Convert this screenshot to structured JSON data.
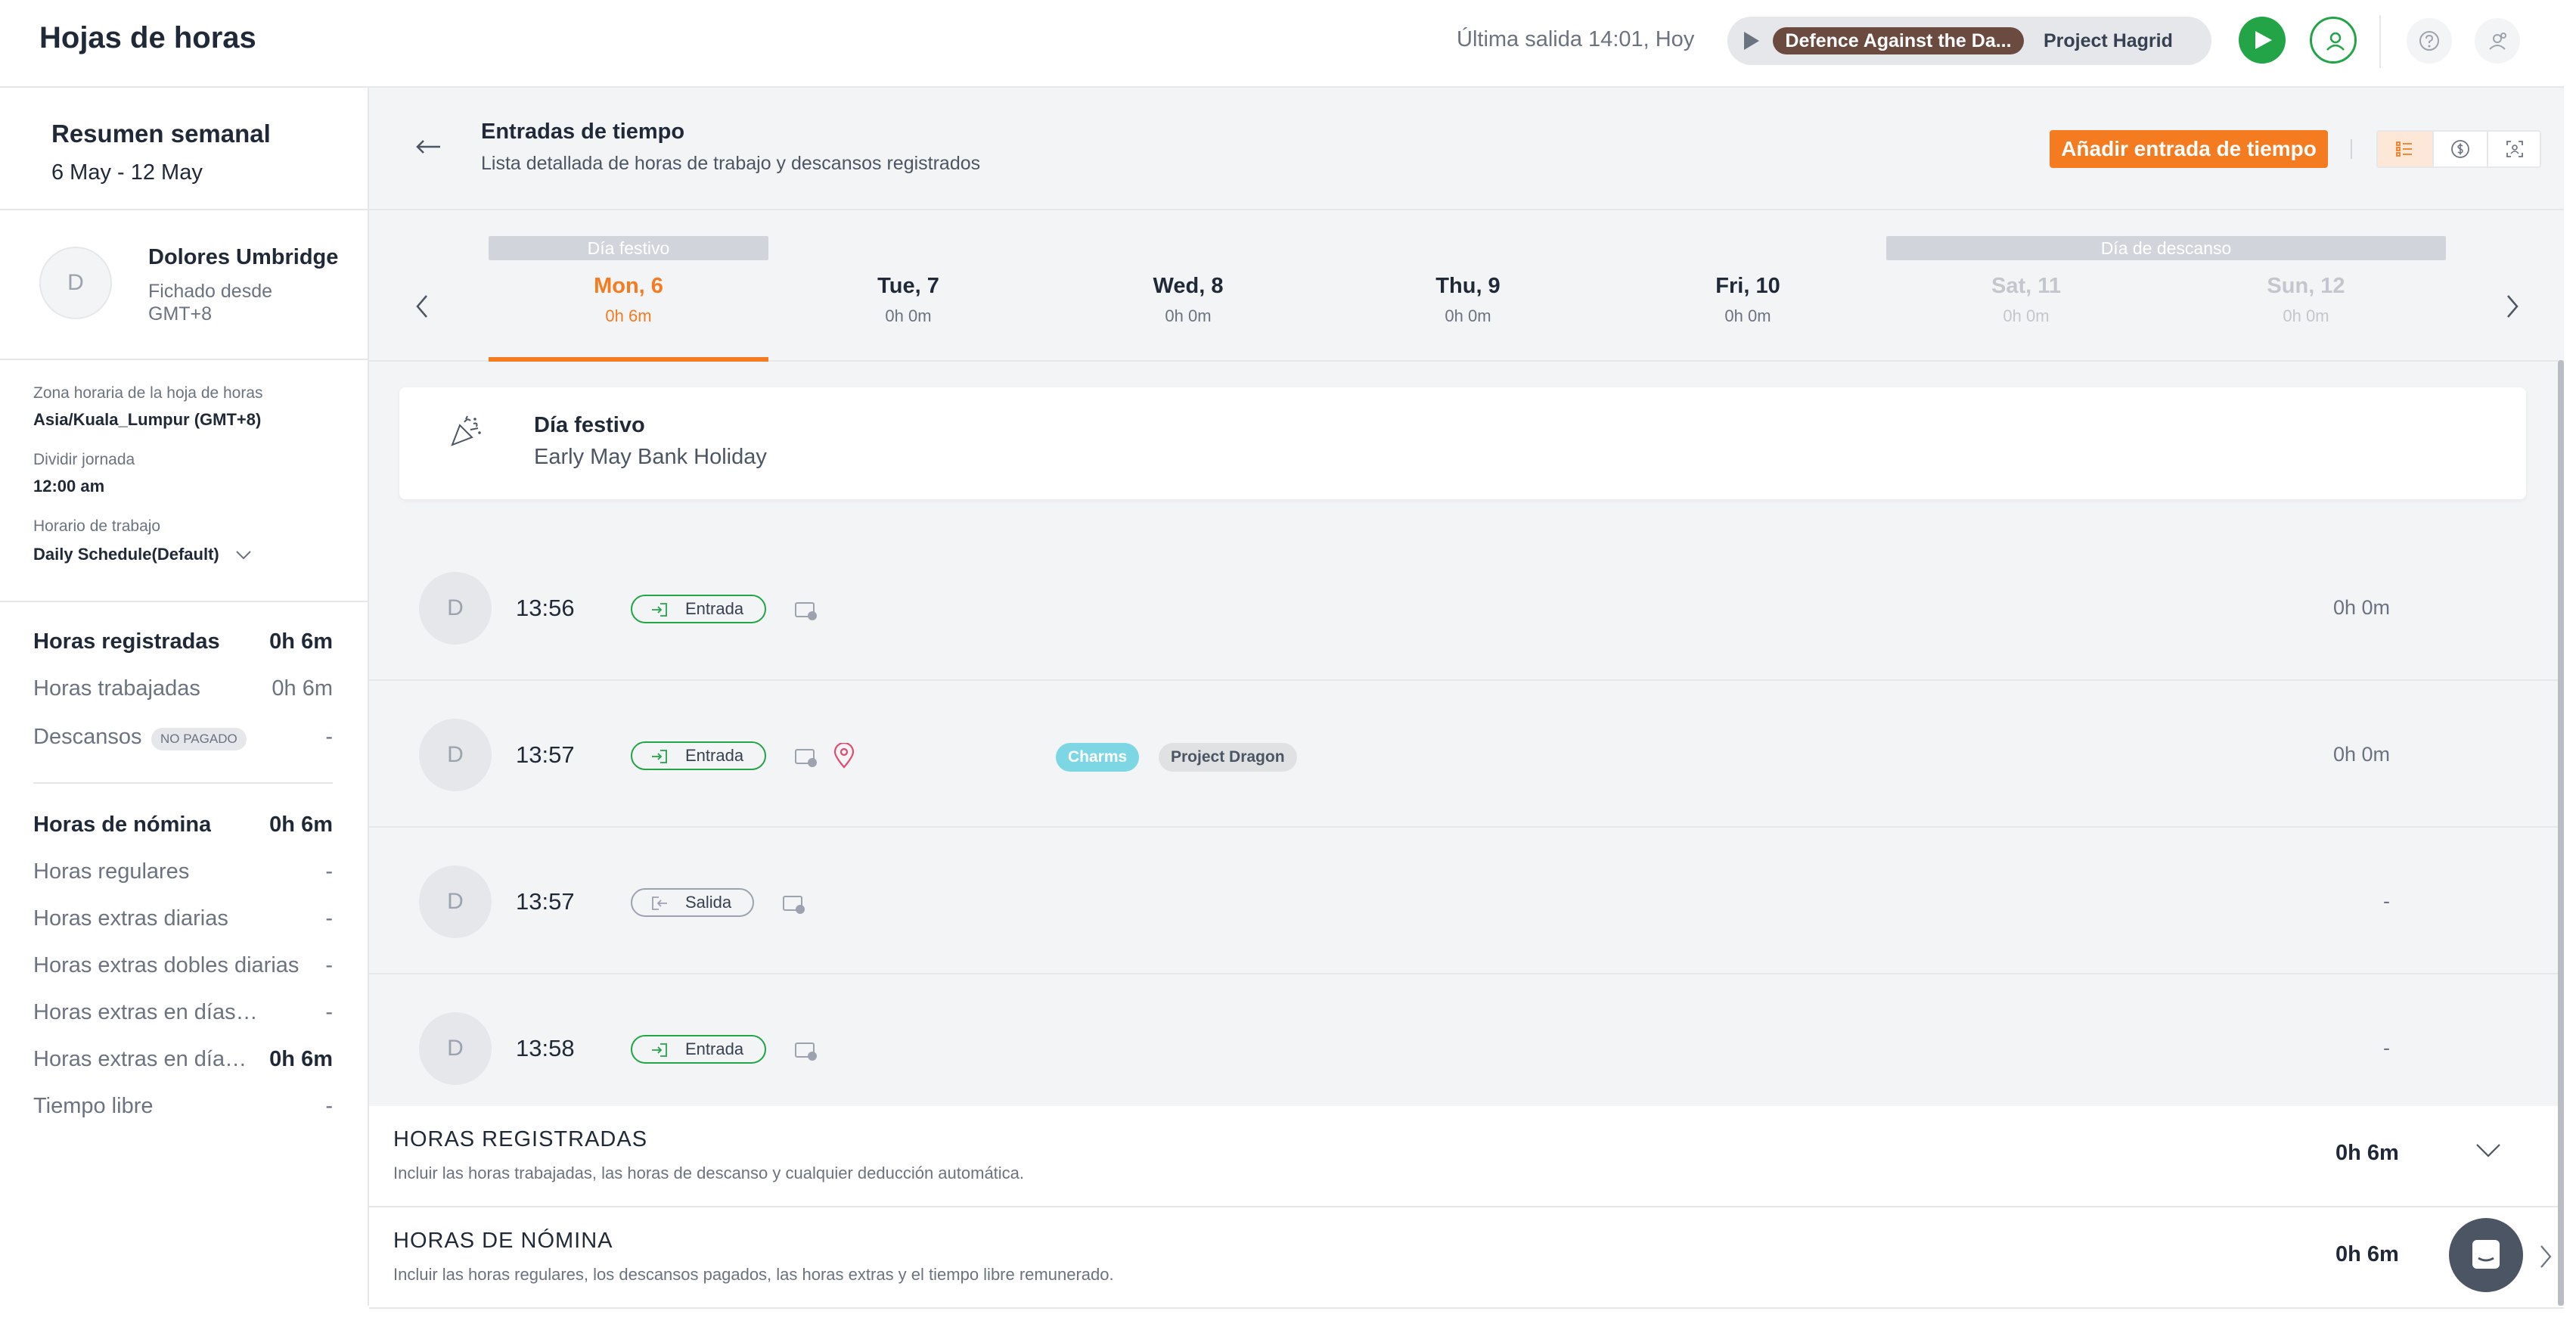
{
  "header": {
    "title": "Hojas de horas",
    "last_out": "Última salida 14:01, Hoy",
    "timer": {
      "task": "Defence Against the Da...",
      "project": "Project Hagrid"
    },
    "icons": [
      "play-icon",
      "user-circle-icon",
      "help-icon",
      "settings-icon"
    ]
  },
  "sidebar": {
    "weekly_title": "Resumen semanal",
    "date_range": "6 May - 12 May",
    "person": {
      "avatar_letter": "D",
      "name": "Dolores Umbridge",
      "sub": "Fichado desde GMT+8"
    },
    "meta": {
      "timezone_label": "Zona horaria de la hoja de horas",
      "timezone_value": "Asia/Kuala_Lumpur (GMT+8)",
      "split_label": "Dividir jornada",
      "split_value": "12:00 am",
      "schedule_label": "Horario de trabajo",
      "schedule_value": "Daily Schedule(Default)"
    },
    "recorded": [
      {
        "label": "Horas registradas",
        "value": "0h 6m"
      },
      {
        "label": "Horas trabajadas",
        "value": "0h 6m"
      },
      {
        "label": "Descansos",
        "badge": "NO PAGADO",
        "value": "-"
      }
    ],
    "payroll": [
      {
        "label": "Horas de nómina",
        "value": "0h 6m"
      },
      {
        "label": "Horas regulares",
        "value": "-"
      },
      {
        "label": "Horas extras diarias",
        "value": "-"
      },
      {
        "label": "Horas extras dobles diarias",
        "value": "-"
      },
      {
        "label": "Horas extras en días de descanso",
        "value": "-"
      },
      {
        "label": "Horas extras en días festivos",
        "value": "0h 6m"
      },
      {
        "label": "Tiempo libre",
        "value": "-"
      }
    ]
  },
  "main": {
    "title": "Entradas de tiempo",
    "subtitle": "Lista detallada de horas de trabajo y descansos registrados",
    "add_button": "Añadir entrada de tiempo",
    "view_icons": [
      "list-view-icon",
      "dollar-icon",
      "scan-icon"
    ],
    "week": {
      "holiday_banner": "Día festivo",
      "rest_banner": "Día de descanso",
      "days": [
        {
          "name": "Mon, 6",
          "hours": "0h 6m"
        },
        {
          "name": "Tue, 7",
          "hours": "0h 0m"
        },
        {
          "name": "Wed, 8",
          "hours": "0h 0m"
        },
        {
          "name": "Thu, 9",
          "hours": "0h 0m"
        },
        {
          "name": "Fri, 10",
          "hours": "0h 0m"
        },
        {
          "name": "Sat, 11",
          "hours": "0h 0m"
        },
        {
          "name": "Sun, 12",
          "hours": "0h 0m"
        }
      ]
    },
    "holiday": {
      "title": "Día festivo",
      "name": "Early May Bank Holiday"
    },
    "entries": [
      {
        "avatar": "D",
        "time": "13:56",
        "type": "Entrada",
        "duration": "0h 0m"
      },
      {
        "avatar": "D",
        "time": "13:57",
        "type": "Entrada",
        "duration": "0h 0m",
        "activity": "Charms",
        "project": "Project Dragon"
      },
      {
        "avatar": "D",
        "time": "13:57",
        "type": "Salida",
        "duration": "-"
      },
      {
        "avatar": "D",
        "time": "13:58",
        "type": "Entrada",
        "duration": "-"
      }
    ],
    "summary": [
      {
        "title": "HORAS REGISTRADAS",
        "desc": "Incluir las horas trabajadas, las horas de descanso y cualquier deducción automática.",
        "value": "0h 6m"
      },
      {
        "title": "HORAS DE NÓMINA",
        "desc": "Incluir las horas regulares, los descansos pagados, las horas extras y el tiempo libre remunerado.",
        "value": "0h 6m"
      }
    ]
  },
  "colors": {
    "accent": "#f47b20",
    "success": "#22a447",
    "charms_tag": "#7dd6e4",
    "timer_task": "#6b4a40"
  }
}
